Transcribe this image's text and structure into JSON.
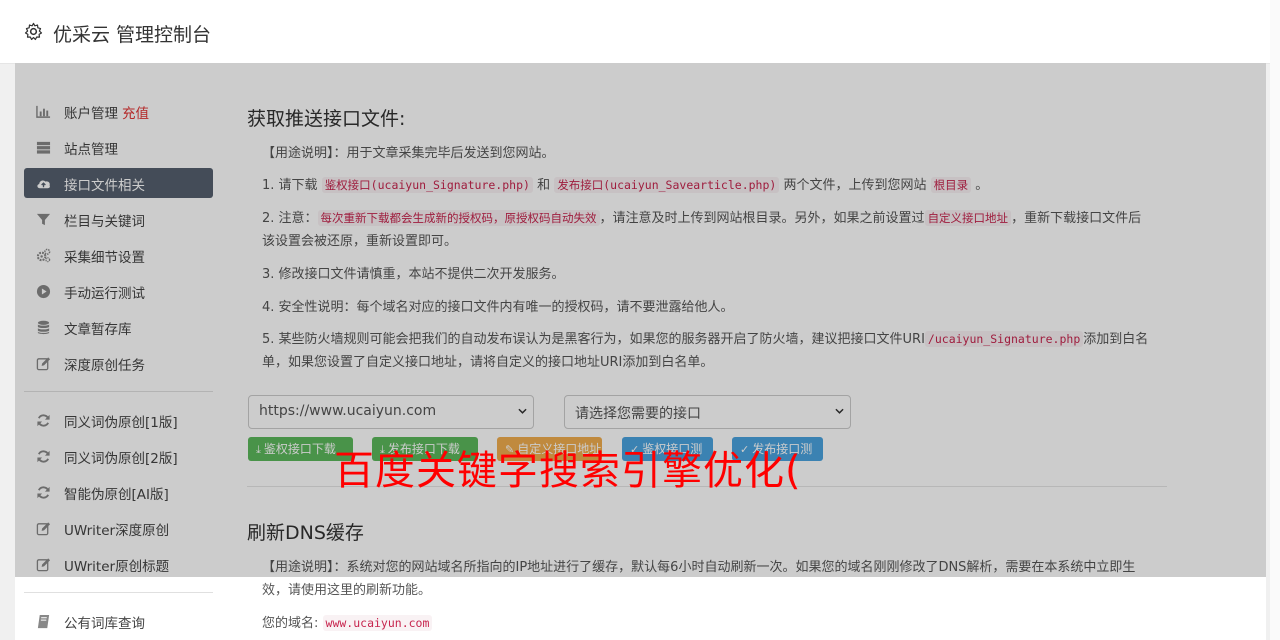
{
  "header": {
    "title": "优采云 管理控制台",
    "icon": "gear-icon"
  },
  "sidebar": {
    "items": [
      {
        "label": "账户管理",
        "extra": "充值",
        "icon": "bar-chart-icon",
        "active": false
      },
      {
        "label": "站点管理",
        "icon": "server-icon",
        "active": false
      },
      {
        "label": "接口文件相关",
        "icon": "cloud-upload-icon",
        "active": true
      },
      {
        "label": "栏目与关键词",
        "icon": "filter-icon",
        "active": false
      },
      {
        "label": "采集细节设置",
        "icon": "cogs-icon",
        "active": false
      },
      {
        "label": "手动运行测试",
        "icon": "play-circle-icon",
        "active": false
      },
      {
        "label": "文章暂存库",
        "icon": "database-icon",
        "active": false
      },
      {
        "label": "深度原创任务",
        "icon": "edit-icon",
        "active": false
      },
      {
        "label": "同义词伪原创[1版]",
        "icon": "refresh-icon",
        "active": false
      },
      {
        "label": "同义词伪原创[2版]",
        "icon": "refresh-icon",
        "active": false
      },
      {
        "label": "智能伪原创[AI版]",
        "icon": "refresh-icon",
        "active": false
      },
      {
        "label": "UWriter深度原创",
        "icon": "edit-icon",
        "active": false
      },
      {
        "label": "UWriter原创标题",
        "icon": "edit-icon",
        "active": false
      },
      {
        "label": "公有词库查询",
        "icon": "book-icon",
        "active": false
      }
    ]
  },
  "push_section": {
    "title": "获取推送接口文件:",
    "usage": "【用途说明】：用于文章采集完毕后发送到您网站。",
    "step1": {
      "prefix": "1. 请下载",
      "code1": "鉴权接口(ucaiyun_Signature.php)",
      "and": "和",
      "code2": "发布接口(ucaiyun_Savearticle.php)",
      "mid": "两个文件，上传到您网站",
      "code3": "根目录",
      "suffix": "。"
    },
    "step2": {
      "prefix": "2. 注意：",
      "code1": "每次重新下载都会生成新的授权码，原授权码自动失效",
      "mid": "，请注意及时上传到网站根目录。另外，如果之前设置过",
      "code2": "自定义接口地址",
      "suffix": "，重新下载接口文件后该设置会被还原，重新设置即可。"
    },
    "step3": "3. 修改接口文件请慎重，本站不提供二次开发服务。",
    "step4": "4. 安全性说明：每个域名对应的接口文件内有唯一的授权码，请不要泄露给他人。",
    "step5": {
      "prefix": "5. 某些防火墙规则可能会把我们的自动发布误认为是黑客行为，如果您的服务器开启了防火墙，建议把接口文件URI",
      "code1": "/ucaiyun_Signature.php",
      "suffix": "添加到白名单，如果您设置了自定义接口地址，请将自定义的接口地址URI添加到白名单。"
    },
    "site_select": "https://www.ucaiyun.com",
    "interface_select": "请选择您需要的接口",
    "buttons": [
      {
        "label": "鉴权接口下载",
        "icon": "download-icon",
        "color": "#5cb85c"
      },
      {
        "label": "发布接口下载",
        "icon": "download-icon",
        "color": "#5cb85c"
      },
      {
        "label": "自定义接口地址",
        "icon": "edit-icon",
        "color": "#f0ad4e"
      },
      {
        "label": "鉴权接口测试",
        "icon": "check-icon",
        "color": "#4aa3df"
      },
      {
        "label": "发布接口测试",
        "icon": "check-icon",
        "color": "#4aa3df"
      }
    ]
  },
  "dns_section": {
    "title": "刷新DNS缓存",
    "usage": "【用途说明】：系统对您的网站域名所指向的IP地址进行了缓存，默认每6小时自动刷新一次。如果您的域名刚刚修改了DNS解析，需要在本系统中立即生效，请使用这里的刷新功能。",
    "domain_label": "您的域名:",
    "domain_value": "www.ucaiyun.com"
  },
  "watermark": "百度关键字搜索引擎优化(",
  "colors": {
    "active_bg": "#55606e",
    "code_text": "#c7254e",
    "code_bg": "#f9f2f4",
    "watermark": "#ff0000"
  }
}
